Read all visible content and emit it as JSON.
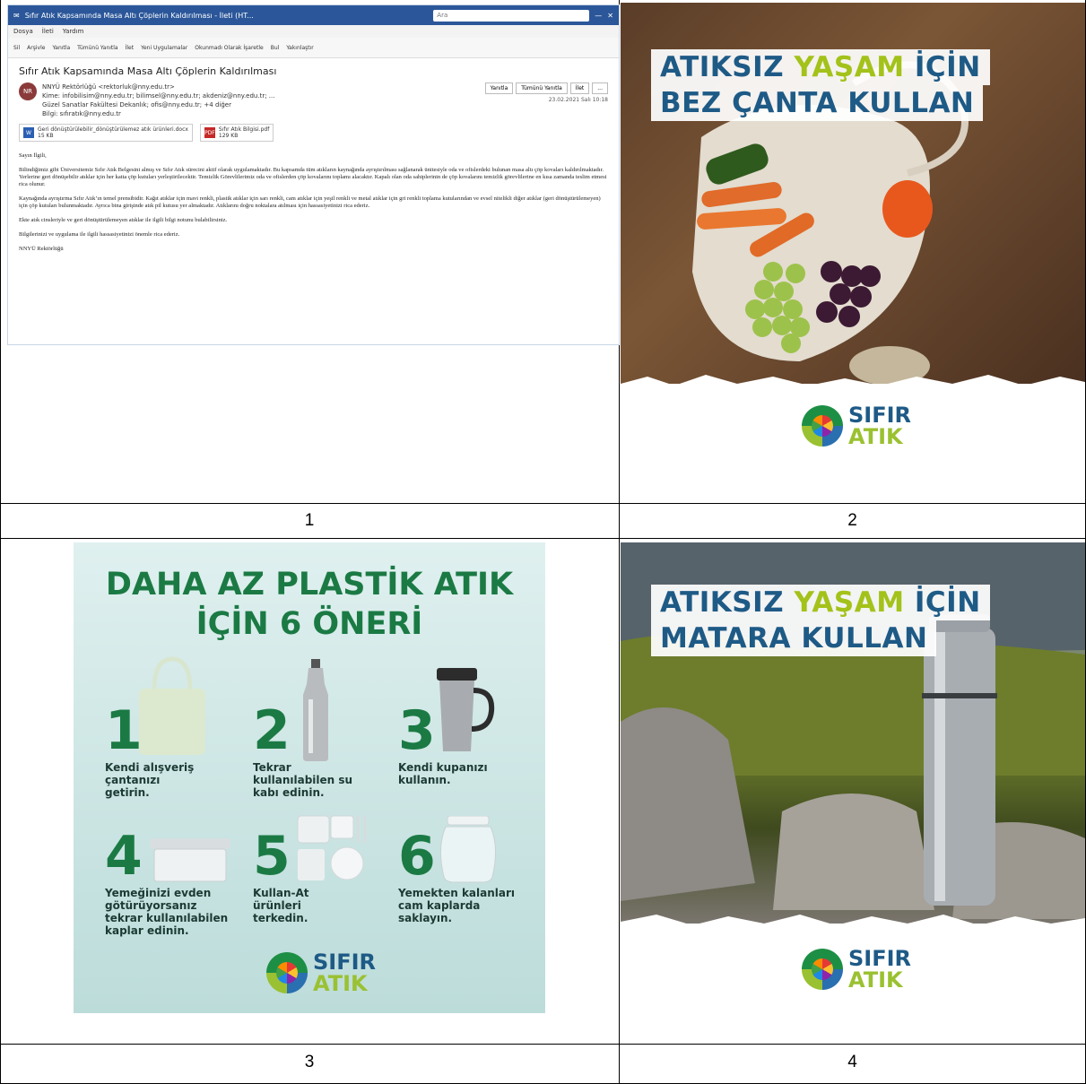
{
  "captions": [
    "1",
    "2",
    "3",
    "4"
  ],
  "email": {
    "window_title": "Sıfır Atık Kapsamında Masa Altı Çöplerin Kaldırılması - İleti (HT...",
    "search_placeholder": "Ara",
    "menu": [
      "Dosya",
      "İleti",
      "Yardım"
    ],
    "ribbon": [
      "Sil",
      "Arşivle",
      "Yanıtla",
      "Tümünü Yanıtla",
      "İlet",
      "Yeni Uygulamalar",
      "Okunmadı Olarak İşaretle",
      "Bul",
      "Yakınlaştır"
    ],
    "subject": "Sıfır Atık Kapsamında Masa Altı Çöplerin Kaldırılması",
    "avatar_initials": "NR",
    "sender": "NNYÜ Rektörlüğü <rektorluk@nny.edu.tr>",
    "to_line": "Kime: infobilisim@nny.edu.tr; bilimsel@nny.edu.tr; akdeniz@nny.edu.tr; ...",
    "to_line2": "Güzel Sanatlar Fakültesi Dekanlık; ofis@nny.edu.tr; +4 diğer",
    "cc_line": "Bilgi: sıfıratık@nny.edu.tr",
    "actions": [
      "Yanıtla",
      "Tümünü Yanıtla",
      "İlet",
      "..."
    ],
    "date": "23.02.2021 Salı 10:18",
    "attachments": [
      {
        "icon": "W",
        "name": "Geri dönüştürülebilir_dönüştürülemez atık ürünleri.docx",
        "size": "15 KB",
        "kind": "word"
      },
      {
        "icon": "PDF",
        "name": "Sıfır Atık Bilgisi.pdf",
        "size": "129 KB",
        "kind": "pdf"
      }
    ],
    "body_greeting": "Sayın İlgili,",
    "body_p1": "Bilindiğimiz gibi Üniversitemiz Sıfır Atık Belgesini almış ve Sıfır Atık sürecini aktif olarak uygulamaktadır. Bu kapsamda tüm atıkların kaynağında ayrıştırılması sağlanarak ünitesiyle oda ve ofislerdeki bulunan masa altı çöp kovaları kaldırılmaktadır. Yerlerine geri dönüşebilir atıklar için her katta çöp kutuları yerleştirilecektir. Temizlik Görevlilerimiz oda ve ofislerden çöp kovalarını toplamı alacaktır. Kapalı olan oda sahiplerinin de çöp kovalarını temizlik görevlilerine en kısa zamanda teslim etmesi rica olunur.",
    "body_p2": "Kaynağında ayrıştırma Sıfır Atık’ın temel prensibidir. Kağıt atıklar için mavi renkli, plastik atıklar için sarı renkli, cam atıklar için yeşil renkli ve metal atıklar için gri renkli toplama kutularından ve evsel nitelikli diğer atıklar (geri dönüştürülemeyen) için çöp kutuları bulunmaktadır. Ayrıca bina girişinde atık pil kutusu yer almaktadır. Atıklarını doğru noktalara atılması için hassasiyetinizi rica ederiz.",
    "body_p3": "Ekte atık cinsleriyle ve geri dönüştürülemeyen atıklar ile ilgili bilgi notunu bulabilirsiniz.",
    "body_p4": "Bilgilerinizi ve uygulama ile ilgili hassasiyetinizi önemle rica ederiz.",
    "signature": "NNYÜ Rektörlüğü"
  },
  "poster2": {
    "line1_a": "ATIKSIZ",
    "line1_b": "YAŞAM",
    "line1_c": "İÇİN",
    "line2": "BEZ ÇANTA KULLAN"
  },
  "poster4": {
    "line1_a": "ATIKSIZ",
    "line1_b": "YAŞAM",
    "line1_c": "İÇİN",
    "line2": "MATARA KULLAN"
  },
  "logo": {
    "word1": "SIFIR",
    "word2": "ATIK"
  },
  "poster3": {
    "title_line1": "DAHA AZ PLASTİK ATIK",
    "title_line2": "İÇİN 6 ÖNERİ",
    "tips": [
      {
        "num": "1",
        "text": "Kendi alışveriş çantanızı getirin."
      },
      {
        "num": "2",
        "text": "Tekrar kullanılabilen su kabı edinin."
      },
      {
        "num": "3",
        "text": "Kendi kupanızı kullanın."
      },
      {
        "num": "4",
        "text": "Yemeğinizi evden götürüyorsanız tekrar kullanılabilen kaplar edinin."
      },
      {
        "num": "5",
        "text": "Kullan-At ürünleri terkedin."
      },
      {
        "num": "6",
        "text": "Yemekten kalanları cam kaplarda saklayın."
      }
    ]
  },
  "colors": {
    "brand_blue": "#1e5a86",
    "brand_green": "#1b7a44",
    "lime": "#a3c21a"
  }
}
